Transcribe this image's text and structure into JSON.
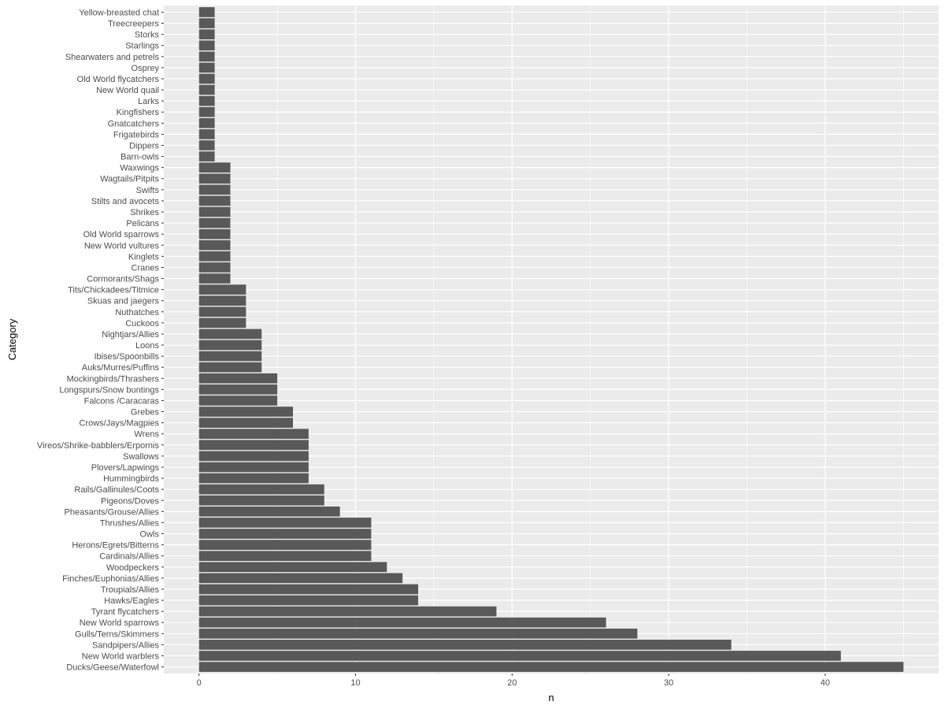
{
  "chart_data": {
    "type": "bar",
    "orientation": "horizontal",
    "title": "",
    "xlabel": "n",
    "ylabel": "Category",
    "xlim": [
      -2.25,
      47.25
    ],
    "x_ticks": [
      0,
      10,
      20,
      30,
      40
    ],
    "grid": true,
    "legend": "none",
    "colors": {
      "bar": "#595959",
      "panel": "#ebebeb",
      "grid": "#ffffff",
      "tick_text": "#4d4d4d",
      "tick_mark": "#333333"
    },
    "categories": [
      "Yellow-breasted chat",
      "Treecreepers",
      "Storks",
      "Starlings",
      "Shearwaters and petrels",
      "Osprey",
      "Old World flycatchers",
      "New World quail",
      "Larks",
      "Kingfishers",
      "Gnatcatchers",
      "Frigatebirds",
      "Dippers",
      "Barn-owls",
      "Waxwings",
      "Wagtails/Pitpits",
      "Swifts",
      "Stilts and avocets",
      "Shrikes",
      "Pelicans",
      "Old World sparrows",
      "New World vultures",
      "Kinglets",
      "Cranes",
      "Cormorants/Shags",
      "Tits/Chickadees/Titmice",
      "Skuas and jaegers",
      "Nuthatches",
      "Cuckoos",
      "Nightjars/Allies",
      "Loons",
      "Ibises/Spoonbills",
      "Auks/Murres/Puffins",
      "Mockingbirds/Thrashers",
      "Longspurs/Snow buntings",
      "Falcons /Caracaras",
      "Grebes",
      "Crows/Jays/Magpies",
      "Wrens",
      "Vireos/Shrike-babblers/Erpornis",
      "Swallows",
      "Plovers/Lapwings",
      "Hummingbirds",
      "Rails/Gallinules/Coots",
      "Pigeons/Doves",
      "Pheasants/Grouse/Allies",
      "Thrushes/Allies",
      "Owls",
      "Herons/Egrets/Bitterns",
      "Cardinals/Allies",
      "Woodpeckers",
      "Finches/Euphonias/Allies",
      "Troupials/Allies",
      "Hawks/Eagles",
      "Tyrant flycatchers",
      "New World sparrows",
      "Gulls/Terns/Skimmers",
      "Sandpipers/Allies",
      "New World warblers",
      "Ducks/Geese/Waterfowl"
    ],
    "values": [
      1,
      1,
      1,
      1,
      1,
      1,
      1,
      1,
      1,
      1,
      1,
      1,
      1,
      1,
      2,
      2,
      2,
      2,
      2,
      2,
      2,
      2,
      2,
      2,
      2,
      3,
      3,
      3,
      3,
      4,
      4,
      4,
      4,
      5,
      5,
      5,
      6,
      6,
      7,
      7,
      7,
      7,
      7,
      8,
      8,
      9,
      11,
      11,
      11,
      11,
      12,
      13,
      14,
      14,
      19,
      26,
      28,
      34,
      41,
      45
    ]
  }
}
